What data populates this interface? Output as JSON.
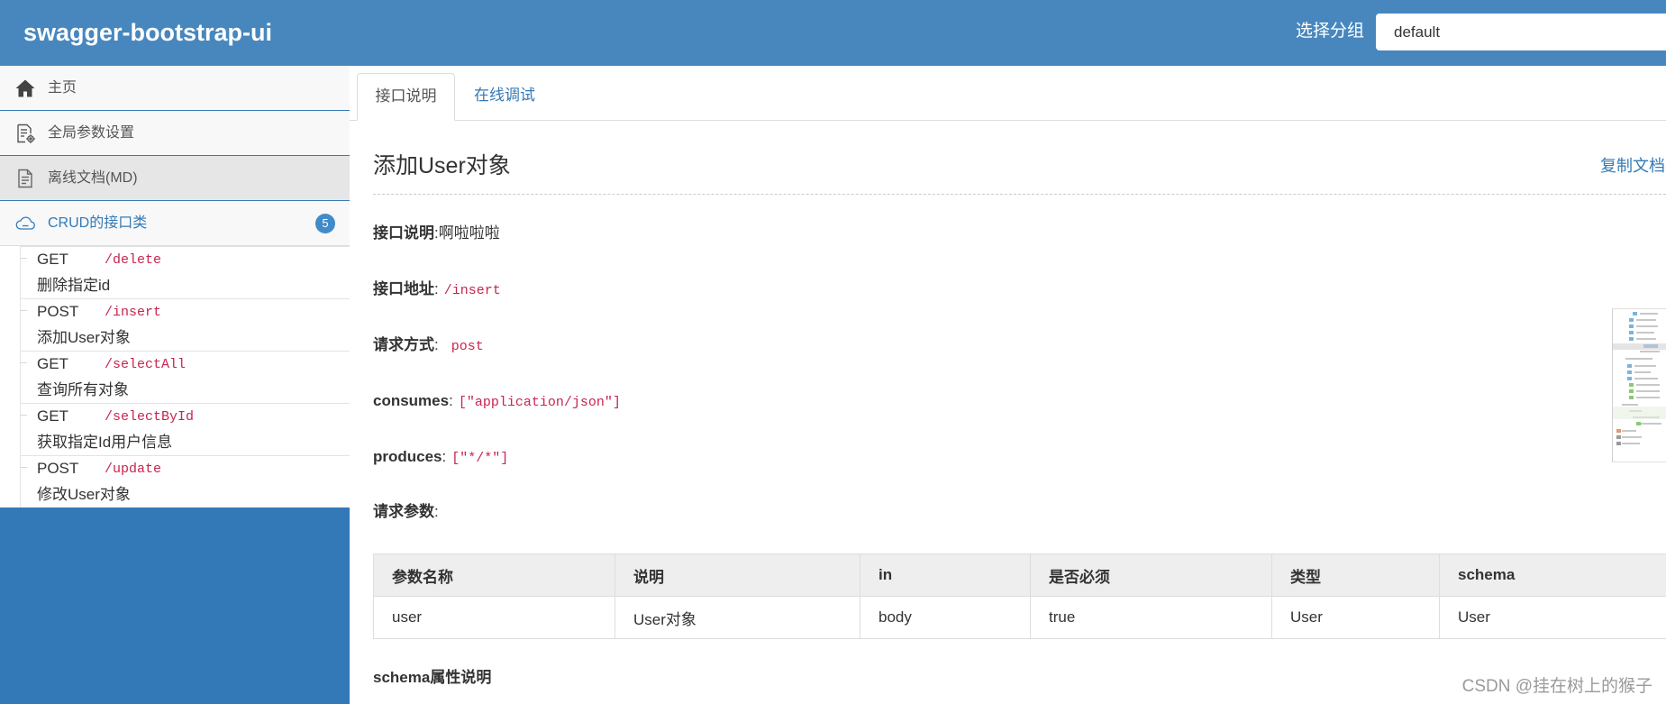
{
  "header": {
    "title": "swagger-bootstrap-ui",
    "group_label": "选择分组",
    "group_value": "default"
  },
  "sidebar": {
    "items": [
      {
        "label": "主页",
        "icon": "home-icon"
      },
      {
        "label": "全局参数设置",
        "icon": "settings-document-icon"
      },
      {
        "label": "离线文档(MD)",
        "icon": "document-icon"
      }
    ],
    "group": {
      "label": "CRUD的接口类",
      "icon": "api-cloud-icon",
      "count": "5"
    },
    "endpoints": [
      {
        "method": "GET",
        "path": "/delete",
        "summary": "删除指定id"
      },
      {
        "method": "POST",
        "path": "/insert",
        "summary": "添加User对象"
      },
      {
        "method": "GET",
        "path": "/selectAll",
        "summary": "查询所有对象"
      },
      {
        "method": "GET",
        "path": "/selectById",
        "summary": "获取指定Id用户信息"
      },
      {
        "method": "POST",
        "path": "/update",
        "summary": "修改User对象"
      }
    ]
  },
  "tabs": [
    {
      "label": "接口说明",
      "active": true
    },
    {
      "label": "在线调试",
      "active": false
    }
  ],
  "doc": {
    "title": "添加User对象",
    "copy_label": "复制文档",
    "fields": {
      "description": {
        "label": "接口说明",
        "sep": ":",
        "value": "啊啦啦啦"
      },
      "address": {
        "label": "接口地址",
        "sep": ":",
        "value": "/insert"
      },
      "method": {
        "label": "请求方式",
        "sep": ":",
        "value": "post"
      },
      "consumes": {
        "label": "consumes",
        "sep": ":",
        "value": "[\"application/json\"]"
      },
      "produces": {
        "label": "produces",
        "sep": ":",
        "value": "[\"*/*\"]"
      },
      "params": {
        "label": "请求参数",
        "sep": ":"
      }
    },
    "params_table": {
      "headers": [
        "参数名称",
        "说明",
        "in",
        "是否必须",
        "类型",
        "schema"
      ],
      "rows": [
        [
          "user",
          "User对象",
          "body",
          "true",
          "User",
          "User"
        ]
      ]
    },
    "schema_label": "schema属性说明"
  },
  "watermark": "CSDN @挂在树上的猴子",
  "colors": {
    "header_bg": "#4787be",
    "sidebar_bg": "#3479b7",
    "link": "#337ab7",
    "code": "#c7254e",
    "badge": "#428bca",
    "table_header_bg": "#eeeeee"
  }
}
